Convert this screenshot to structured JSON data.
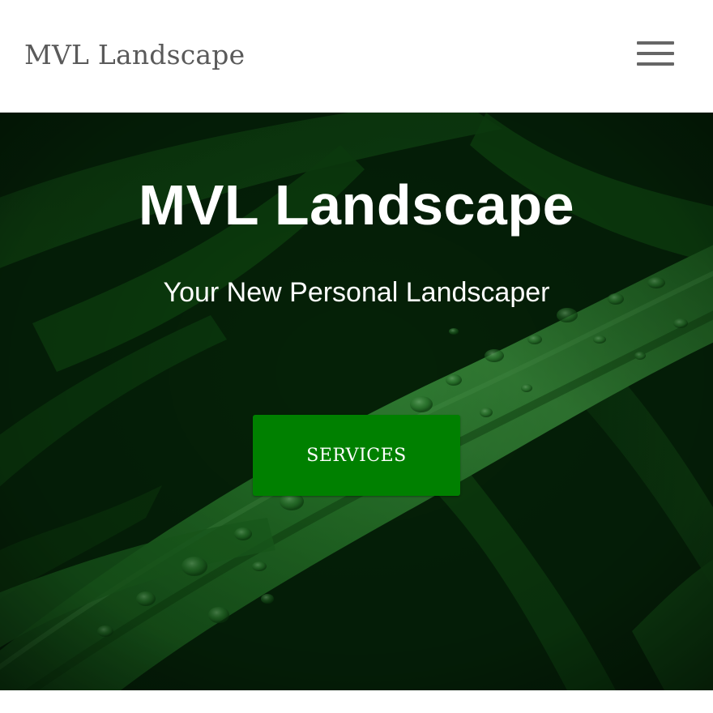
{
  "header": {
    "brand": "MVL Landscape",
    "menu_icon": "hamburger-menu-icon"
  },
  "hero": {
    "title": "MVL Landscape",
    "subtitle": "Your New Personal Landscaper",
    "cta_label": "SERVICES",
    "background": "green leaf with water droplets"
  },
  "colors": {
    "header_bg": "#ffffff",
    "brand_text": "#5a5a5a",
    "menu_icon": "#666666",
    "hero_overlay": "#0b3d0f",
    "cta_bg": "#008000",
    "cta_text": "#ffffff"
  }
}
